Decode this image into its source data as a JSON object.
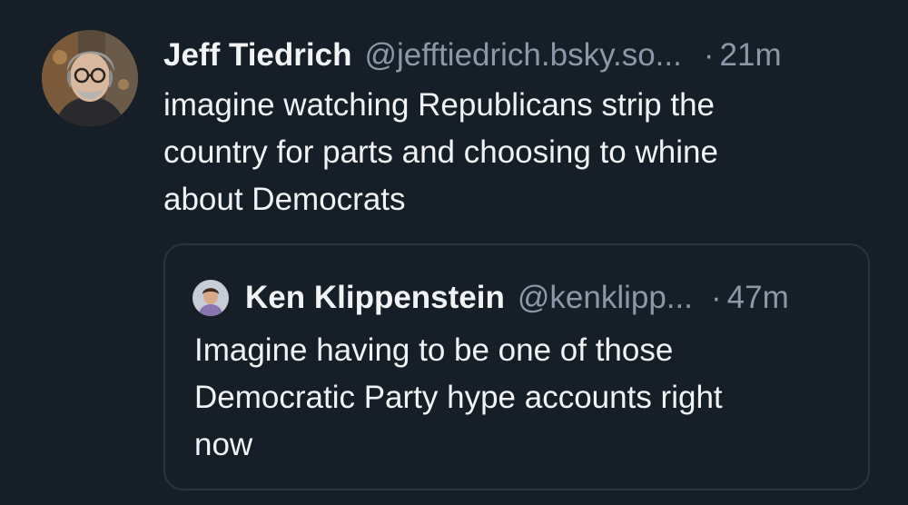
{
  "post": {
    "author": {
      "name": "Jeff Tiedrich",
      "handle": "@jefftiedrich.bsky.so...",
      "avatar_icon": "person-avatar-icon"
    },
    "separator": "·",
    "timestamp": "21m",
    "text": "imagine watching Republicans strip the\ncountry for parts and choosing to whine\nabout Democrats"
  },
  "quote": {
    "author": {
      "name": "Ken Klippenstein",
      "handle": "@kenklipp...",
      "avatar_icon": "person-avatar-icon"
    },
    "separator": "·",
    "timestamp": "47m",
    "text": "Imagine having to be one of those\nDemocratic Party hype accounts right\nnow"
  },
  "colors": {
    "background": "#161e27",
    "text_primary": "#f1f3f5",
    "text_secondary": "#8b98a8",
    "quote_border": "#2a3340"
  }
}
